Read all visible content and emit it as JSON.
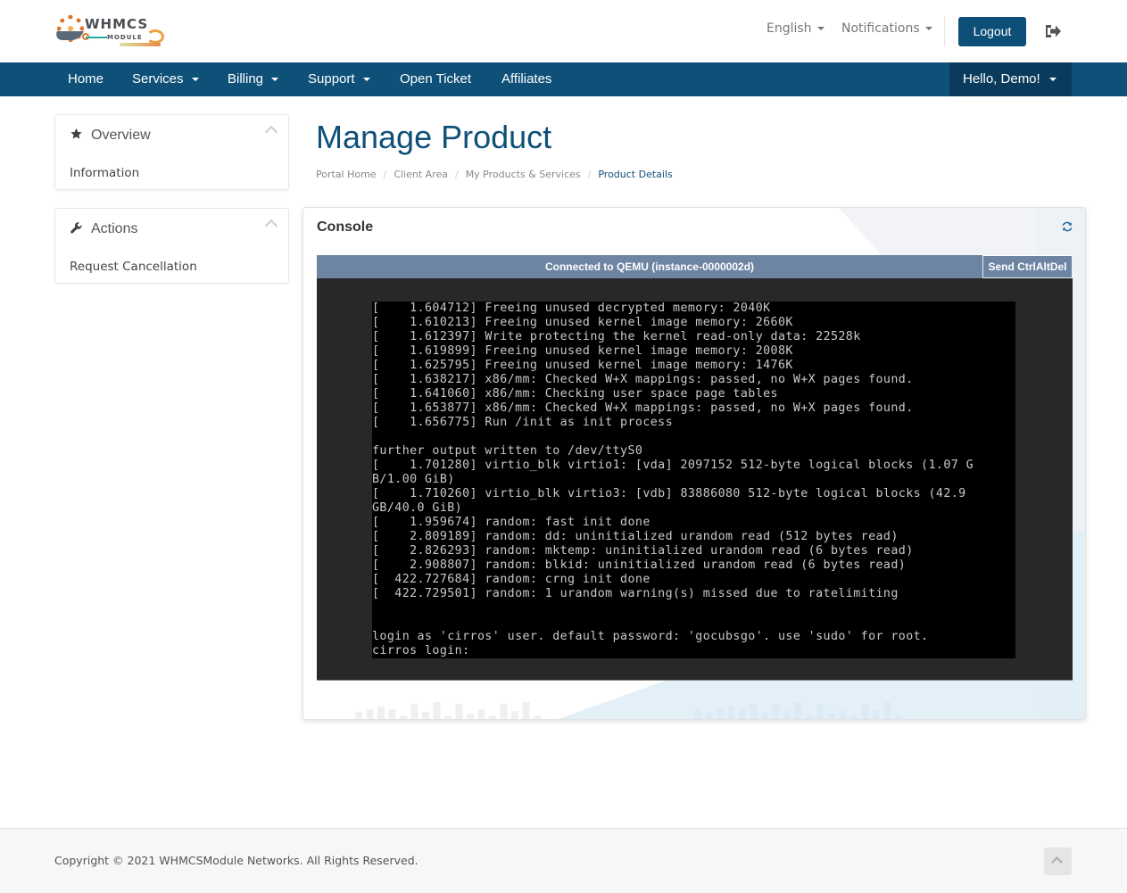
{
  "brand": {
    "logo_text_main": "WHMCS",
    "logo_text_sub": "MODULE"
  },
  "header": {
    "language_label": "English",
    "notifications_label": "Notifications",
    "logout_label": "Logout",
    "logout_icon": "sign-out-icon"
  },
  "nav": {
    "items": [
      {
        "label": "Home",
        "dropdown": false
      },
      {
        "label": "Services",
        "dropdown": true
      },
      {
        "label": "Billing",
        "dropdown": true
      },
      {
        "label": "Support",
        "dropdown": true
      },
      {
        "label": "Open Ticket",
        "dropdown": false
      },
      {
        "label": "Affiliates",
        "dropdown": false
      }
    ],
    "user_label": "Hello, Demo!"
  },
  "sidebar": {
    "panels": [
      {
        "title": "Overview",
        "icon": "star-icon",
        "items": [
          "Information"
        ]
      },
      {
        "title": "Actions",
        "icon": "wrench-icon",
        "items": [
          "Request Cancellation"
        ]
      }
    ]
  },
  "page": {
    "title": "Manage Product",
    "breadcrumb": [
      "Portal Home",
      "Client Area",
      "My Products & Services",
      "Product Details"
    ]
  },
  "console": {
    "title": "Console",
    "refresh_icon": "refresh-icon",
    "status_text": "Connected to QEMU (instance-0000002d)",
    "send_cad_label": "Send CtrlAltDel",
    "terminal_lines": [
      "[    1.604712] Freeing unused decrypted memory: 2040K",
      "[    1.610213] Freeing unused kernel image memory: 2660K",
      "[    1.612397] Write protecting the kernel read-only data: 22528k",
      "[    1.619899] Freeing unused kernel image memory: 2008K",
      "[    1.625795] Freeing unused kernel image memory: 1476K",
      "[    1.638217] x86/mm: Checked W+X mappings: passed, no W+X pages found.",
      "[    1.641060] x86/mm: Checking user space page tables",
      "[    1.653877] x86/mm: Checked W+X mappings: passed, no W+X pages found.",
      "[    1.656775] Run /init as init process",
      "",
      "further output written to /dev/ttyS0",
      "[    1.701280] virtio_blk virtio1: [vda] 2097152 512-byte logical blocks (1.07 G",
      "B/1.00 GiB)",
      "[    1.710260] virtio_blk virtio3: [vdb] 83886080 512-byte logical blocks (42.9",
      "GB/40.0 GiB)",
      "[    1.959674] random: fast init done",
      "[    2.809189] random: dd: uninitialized urandom read (512 bytes read)",
      "[    2.826293] random: mktemp: uninitialized urandom read (6 bytes read)",
      "[    2.908807] random: blkid: uninitialized urandom read (6 bytes read)",
      "[  422.727684] random: crng init done",
      "[  422.729501] random: 1 urandom warning(s) missed due to ratelimiting",
      "",
      "",
      "login as 'cirros' user. default password: 'gocubsgo'. use 'sudo' for root.",
      "cirros login:"
    ]
  },
  "footer": {
    "copyright": "Copyright © 2021 WHMCSModule Networks. All Rights Reserved.",
    "back_to_top_icon": "chevron-up-icon"
  },
  "colors": {
    "brand_primary": "#0e5078",
    "nav_user_bg": "#0a3b5c",
    "vnc_bar": "#6e84a3",
    "terminal_bg": "#000000",
    "terminal_fg": "#c8c8c8"
  }
}
